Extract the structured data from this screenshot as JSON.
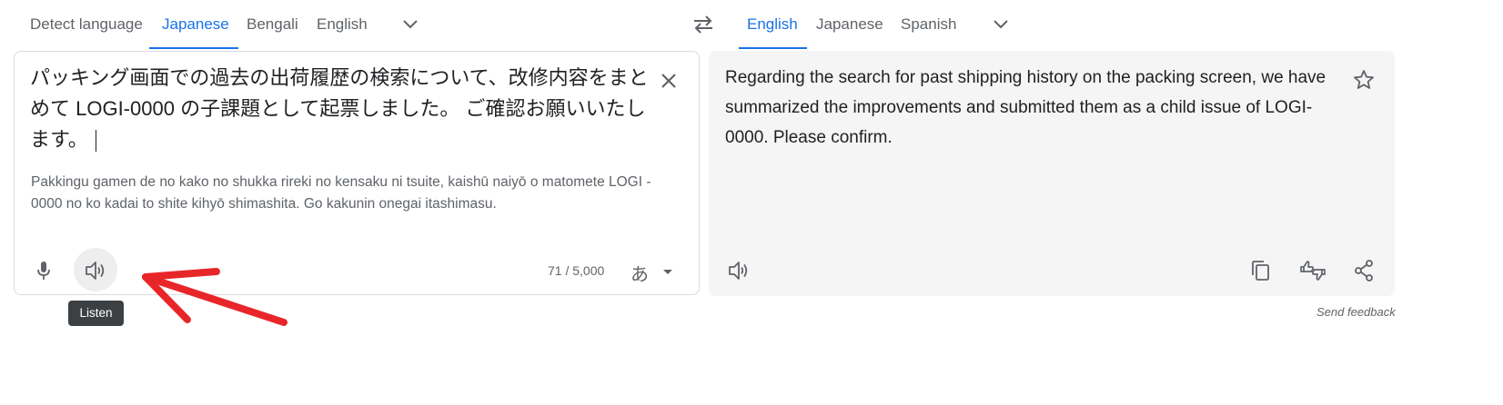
{
  "source_languages": {
    "tabs": [
      {
        "label": "Detect language",
        "active": false
      },
      {
        "label": "Japanese",
        "active": true
      },
      {
        "label": "Bengali",
        "active": false
      },
      {
        "label": "English",
        "active": false
      }
    ]
  },
  "target_languages": {
    "tabs": [
      {
        "label": "English",
        "active": true
      },
      {
        "label": "Japanese",
        "active": false
      },
      {
        "label": "Spanish",
        "active": false
      }
    ]
  },
  "source": {
    "text": "パッキング画面での過去の出荷履歴の検索について、改修内容をまとめて LOGI-0000 の子課題として起票しました。 ご確認お願いいたします。",
    "romanization": "Pakkingu gamen de no kako no shukka rireki no kensaku ni tsuite, kaishū naiyō o matomete LOGI - 0000 no ko kadai to shite kihyō shimashita. Go kakunin onegai itashimasu.",
    "char_count": "71 / 5,000",
    "input_tool_label": "あ",
    "listen_tooltip": "Listen"
  },
  "target": {
    "text": "Regarding the search for past shipping history on the packing screen, we have summarized the improvements and submitted them as a child issue of LOGI-0000. Please confirm."
  },
  "footer": {
    "send_feedback": "Send feedback"
  },
  "colors": {
    "accent": "#1a73e8",
    "annotation_arrow": "#e8262a",
    "target_panel_bg": "#f5f5f5",
    "tooltip_bg": "#3c4043"
  },
  "icons": {
    "swap": "swap-languages-icon",
    "clear": "close-icon",
    "star": "star-icon",
    "mic": "microphone-icon",
    "listen": "speaker-icon",
    "copy": "copy-icon",
    "rate": "rate-translation-icon",
    "share": "share-icon"
  }
}
